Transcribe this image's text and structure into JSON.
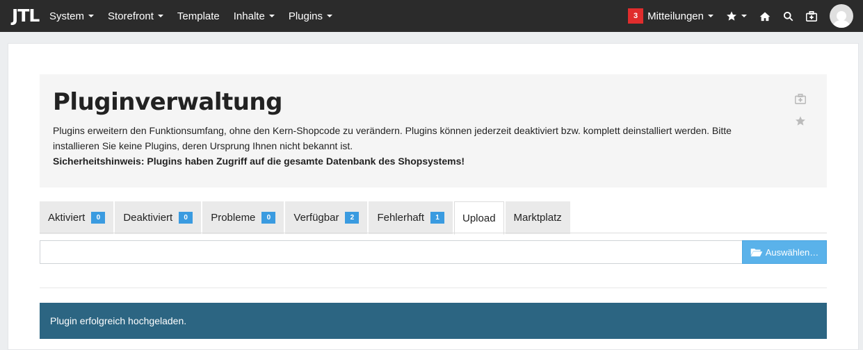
{
  "app": {
    "logo": "JTL"
  },
  "nav": {
    "items": [
      {
        "label": "System",
        "has_caret": true
      },
      {
        "label": "Storefront",
        "has_caret": true
      },
      {
        "label": "Template",
        "has_caret": false
      },
      {
        "label": "Inhalte",
        "has_caret": true
      },
      {
        "label": "Plugins",
        "has_caret": true
      }
    ],
    "notifications": {
      "count": "3",
      "label": "Mitteilungen"
    },
    "icons": [
      "star-icon",
      "home-icon",
      "search-icon",
      "medkit-icon",
      "avatar"
    ]
  },
  "page": {
    "title": "Pluginverwaltung",
    "description": "Plugins erweitern den Funktionsumfang, ohne den Kern-Shopcode zu verändern. Plugins können jederzeit deaktiviert bzw. komplett deinstalliert werden. Bitte installieren Sie keine Plugins, deren Ursprung Ihnen nicht bekannt ist.",
    "warning": "Sicherheitshinweis: Plugins haben Zugriff auf die gesamte Datenbank des Shopsystems!"
  },
  "tabs": [
    {
      "label": "Aktiviert",
      "count": "0"
    },
    {
      "label": "Deaktiviert",
      "count": "0"
    },
    {
      "label": "Probleme",
      "count": "0"
    },
    {
      "label": "Verfügbar",
      "count": "2"
    },
    {
      "label": "Fehlerhaft",
      "count": "1"
    },
    {
      "label": "Upload",
      "count": null,
      "active": true
    },
    {
      "label": "Marktplatz",
      "count": null
    }
  ],
  "upload": {
    "value": "",
    "button_label": "Auswählen…"
  },
  "alert": {
    "message": "Plugin erfolgreich hochgeladen."
  },
  "colors": {
    "topbar": "#2b2b2b",
    "badge_red": "#e02d2d",
    "count_badge": "#3a9be0",
    "alert_bg": "#2c6582",
    "button": "#5ab2ea"
  }
}
